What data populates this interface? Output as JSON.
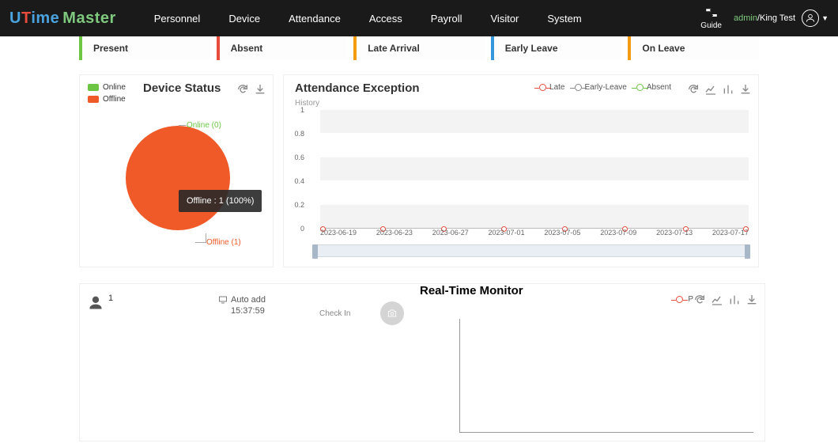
{
  "brand": {
    "part1": "U",
    "part2": "T",
    "part3": "ime",
    "part4": "Master"
  },
  "nav": [
    "Personnel",
    "Device",
    "Attendance",
    "Access",
    "Payroll",
    "Visitor",
    "System"
  ],
  "guide": "Guide",
  "user": {
    "name1": "admin",
    "sep": "/",
    "name2": "King Test"
  },
  "tabs": {
    "present": "Present",
    "absent": "Absent",
    "late": "Late Arrival",
    "early": "Early Leave",
    "leave": "On Leave"
  },
  "device": {
    "title": "Device Status",
    "legend_online": "Online",
    "legend_offline": "Offline",
    "label_online": "Online (0)",
    "label_offline": "Offline (1)",
    "tooltip": "Offline : 1 (100%)"
  },
  "attendance": {
    "title": "Attendance Exception",
    "sub": "History",
    "legend": {
      "late": "Late",
      "early": "Early-Leave",
      "absent": "Absent"
    },
    "y": [
      "1",
      "0.8",
      "0.6",
      "0.4",
      "0.2",
      "0"
    ],
    "x": [
      "2023-06-19",
      "2023-06-23",
      "2023-06-27",
      "2023-07-01",
      "2023-07-05",
      "2023-07-09",
      "2023-07-13",
      "2023-07-17"
    ]
  },
  "chart_data": {
    "device_status": {
      "type": "pie",
      "series": [
        {
          "name": "Online",
          "value": 0
        },
        {
          "name": "Offline",
          "value": 1
        }
      ]
    },
    "attendance_exception": {
      "type": "line",
      "categories": [
        "2023-06-19",
        "2023-06-23",
        "2023-06-27",
        "2023-07-01",
        "2023-07-05",
        "2023-07-09",
        "2023-07-13",
        "2023-07-17"
      ],
      "ylim": [
        0,
        1
      ],
      "series": [
        {
          "name": "Late",
          "values": [
            0,
            0,
            0,
            0,
            0,
            0,
            0,
            0
          ]
        },
        {
          "name": "Early-Leave",
          "values": [
            0,
            0,
            0,
            0,
            0,
            0,
            0,
            0
          ]
        },
        {
          "name": "Absent",
          "values": [
            0,
            0,
            0,
            0,
            0,
            0,
            0,
            0
          ]
        }
      ]
    },
    "real_time_monitor": {
      "type": "line",
      "series": [
        {
          "name": "P",
          "values": []
        }
      ]
    }
  },
  "event": {
    "id": "1",
    "auto": "Auto add",
    "time": "15:37:59",
    "checkin": "Check In"
  },
  "rtm": {
    "title": "Real-Time Monitor",
    "legend": "P"
  }
}
